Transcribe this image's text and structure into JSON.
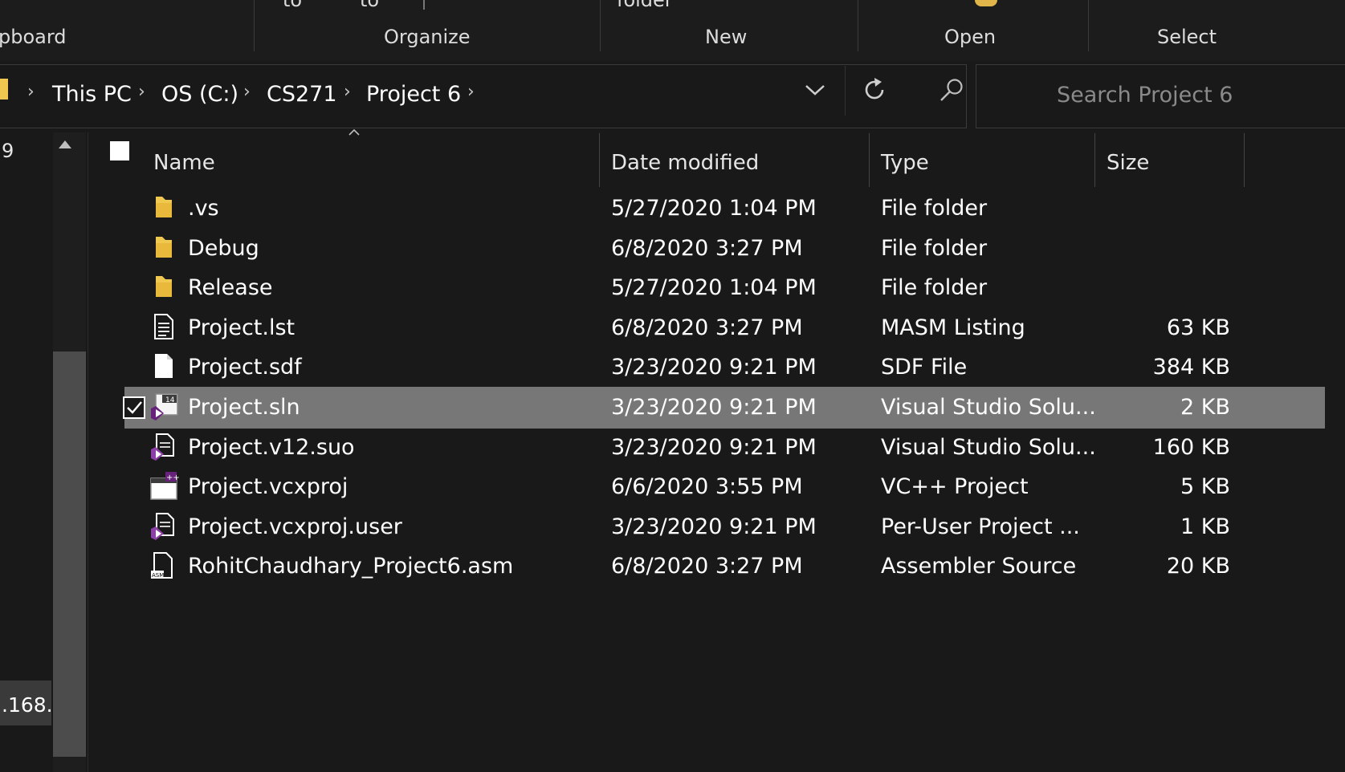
{
  "ribbon": {
    "top_fragments": [
      "to",
      "to",
      "folder"
    ],
    "groups": [
      "pboard",
      "Organize",
      "New",
      "Open",
      "Select"
    ]
  },
  "address": {
    "crumbs": [
      "This PC",
      "OS (C:)",
      "CS271",
      "Project 6"
    ],
    "search_placeholder": "Search Project 6"
  },
  "nav": {
    "top_fragment": "9",
    "bottom_fragment": ".168."
  },
  "columns": {
    "name": "Name",
    "date": "Date modified",
    "type": "Type",
    "size": "Size"
  },
  "files": [
    {
      "name": ".vs",
      "date": "5/27/2020 1:04 PM",
      "type": "File folder",
      "size": "",
      "icon": "folder-icon"
    },
    {
      "name": "Debug",
      "date": "6/8/2020 3:27 PM",
      "type": "File folder",
      "size": "",
      "icon": "folder-icon"
    },
    {
      "name": "Release",
      "date": "5/27/2020 1:04 PM",
      "type": "File folder",
      "size": "",
      "icon": "folder-icon"
    },
    {
      "name": "Project.lst",
      "date": "6/8/2020 3:27 PM",
      "type": "MASM Listing",
      "size": "63 KB",
      "icon": "text-document-icon"
    },
    {
      "name": "Project.sdf",
      "date": "3/23/2020 9:21 PM",
      "type": "SDF File",
      "size": "384 KB",
      "icon": "blank-document-icon"
    },
    {
      "name": "Project.sln",
      "date": "3/23/2020 9:21 PM",
      "type": "Visual Studio Solu...",
      "size": "2 KB",
      "icon": "visual-studio-solution-icon",
      "selected": true
    },
    {
      "name": "Project.v12.suo",
      "date": "3/23/2020 9:21 PM",
      "type": "Visual Studio Solu...",
      "size": "160 KB",
      "icon": "visual-studio-document-icon"
    },
    {
      "name": "Project.vcxproj",
      "date": "6/6/2020 3:55 PM",
      "type": "VC++ Project",
      "size": "5 KB",
      "icon": "vcxproj-icon"
    },
    {
      "name": "Project.vcxproj.user",
      "date": "3/23/2020 9:21 PM",
      "type": "Per-User Project ...",
      "size": "1 KB",
      "icon": "visual-studio-document-icon"
    },
    {
      "name": "RohitChaudhary_Project6.asm",
      "date": "6/8/2020 3:27 PM",
      "type": "Assembler Source",
      "size": "20 KB",
      "icon": "asm-document-icon"
    }
  ],
  "colors": {
    "background": "#191919",
    "selected_row": "#777777",
    "folder": "#f0c74f",
    "vs_purple": "#68217a"
  }
}
